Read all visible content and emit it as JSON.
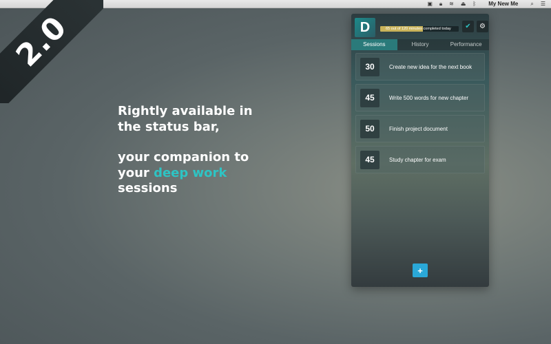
{
  "banner": {
    "version": "2.0"
  },
  "menubar": {
    "icons": [
      "display-icon",
      "lock-icon",
      "wifi-icon",
      "eject-icon",
      "bluetooth-icon",
      "search-icon",
      "list-icon"
    ],
    "title": "My New Me"
  },
  "headline": {
    "line1": "Rightly available in",
    "line2": "the status bar,",
    "line3": "your companion to",
    "line4_prefix": "your ",
    "line4_accent": "deep work",
    "line5": "sessions"
  },
  "panel": {
    "logo_letter": "D",
    "progress": {
      "text": "65 out of 120 minutes completed today",
      "completed": 65,
      "total": 120
    },
    "tabs": [
      {
        "label": "Sessions",
        "active": true
      },
      {
        "label": "History",
        "active": false
      },
      {
        "label": "Performance",
        "active": false
      }
    ],
    "sessions": [
      {
        "minutes": "30",
        "label": "Create new idea for the next book"
      },
      {
        "minutes": "45",
        "label": "Write 500 words for new chapter"
      },
      {
        "minutes": "50",
        "label": "Finish project document"
      },
      {
        "minutes": "45",
        "label": "Study chapter for exam"
      }
    ],
    "add_label": "+"
  },
  "colors": {
    "accent": "#2ec4c4",
    "progress": "#c9b35a",
    "add_button": "#2aa8d8",
    "tab_active": "#2a7a7a"
  }
}
